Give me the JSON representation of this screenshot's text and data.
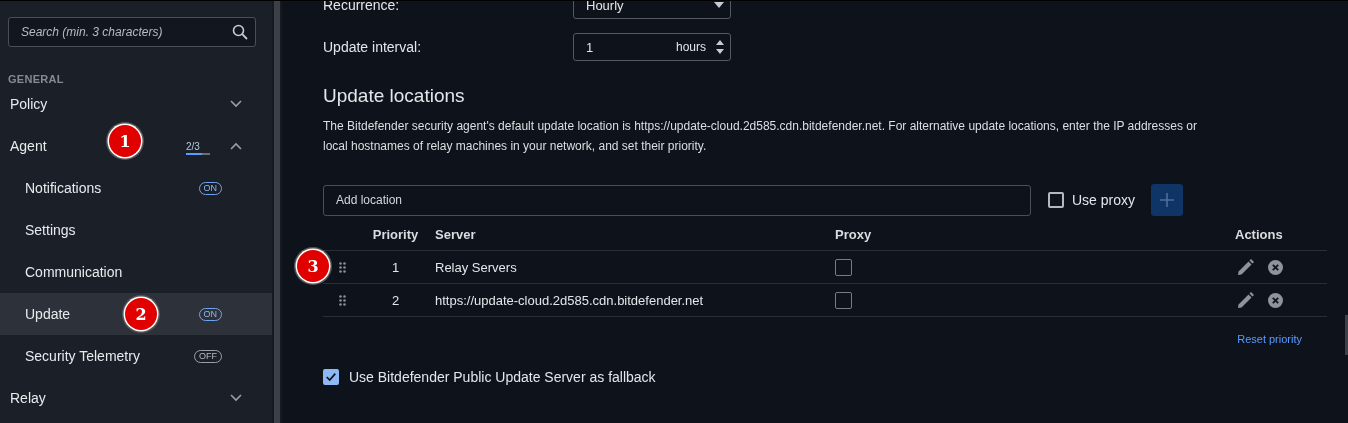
{
  "search": {
    "placeholder": "Search (min. 3 characters)"
  },
  "sidebar": {
    "section": "GENERAL",
    "items": [
      {
        "label": "Policy",
        "expanded": false
      },
      {
        "label": "Agent",
        "expanded": true,
        "marker": "1",
        "progress": {
          "text": "2/3",
          "level": 0.667
        },
        "children": [
          {
            "label": "Notifications",
            "selected": false,
            "toggle": {
              "text": "ON",
              "on": true
            }
          },
          {
            "label": "Settings",
            "selected": false
          },
          {
            "label": "Communication",
            "selected": false
          },
          {
            "label": "Update",
            "selected": true,
            "marker": "2",
            "toggle": {
              "text": "ON",
              "on": true
            }
          },
          {
            "label": "Security Telemetry",
            "selected": false,
            "toggle": {
              "text": "OFF",
              "on": false
            }
          }
        ]
      },
      {
        "label": "Relay",
        "expanded": false
      }
    ]
  },
  "fields": [
    {
      "label": "Recurrence:",
      "kind": "select",
      "value": "Hourly"
    },
    {
      "label": "Update interval:",
      "kind": "spinner",
      "value": "1",
      "unit": "hours"
    }
  ],
  "locations": {
    "title": "Update locations",
    "description": "The Bitdefender security agent's default update location is https://update-cloud.2d585.cdn.bitdefender.net. For alternative update locations, enter the IP addresses or local hostnames of relay machines in your network, and set their priority.",
    "add_placeholder": "Add location",
    "use_proxy": {
      "label": "Use proxy",
      "checked": false
    },
    "columns": [
      "Priority",
      "Server",
      "Proxy",
      "Actions"
    ],
    "rows": [
      {
        "priority": "1",
        "server": "Relay Servers",
        "proxy": false,
        "marker": "3"
      },
      {
        "priority": "2",
        "server": "https://update-cloud.2d585.cdn.bitdefender.net",
        "proxy": false
      }
    ],
    "reset_link": "Reset priority"
  },
  "fallback": {
    "label": "Use Bitdefender Public Update Server as fallback",
    "checked": true
  }
}
